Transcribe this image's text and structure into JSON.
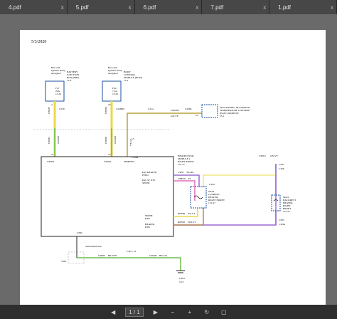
{
  "tabs": [
    {
      "label": "4.pdf",
      "close": "x"
    },
    {
      "label": "5.pdf",
      "close": "x"
    },
    {
      "label": "6.pdf",
      "close": "x"
    },
    {
      "label": "7.pdf",
      "close": "x"
    },
    {
      "label": "1.pdf",
      "close": "x"
    }
  ],
  "document": {
    "date": "5/3/2020",
    "modules": {
      "hot1": [
        "Hot with",
        "Ignition Relay",
        "energized"
      ],
      "hot2": [
        "Hot with",
        "Ignition Relay",
        "energized"
      ],
      "bjb": [
        "BATTERY",
        "JUNCTION",
        "BOX (BJB)"
      ],
      "bjb_ref": "11-6",
      "bcm": [
        "BODY",
        "CONTROL",
        "MODULE (BCM)"
      ],
      "bcm_ref": "11-4",
      "fuse1": [
        "F47",
        "20A",
        "13-25"
      ],
      "fuse2": [
        "F60",
        "7.5A",
        "13-25"
      ],
      "eatc": [
        "ELECTRONIC AUTOMATIC",
        "TEMPERATURE CONTROL",
        "(EATC) MODULE"
      ],
      "eatc_ref": "55-1",
      "seat_module": [
        "HEATED SEAT",
        "MODULE (",
        "RIGHT FRONT",
        "151-27"
      ],
      "pin_vpwr1": "VPWR",
      "pin_vpwr2": "VPWR",
      "pin_tempset": "TEMPSET",
      "pin_pas_feed": [
        "PAS HEATER",
        "FEED"
      ],
      "pin_pas_ntc": [
        "PAS ST NTC",
        "SENSE"
      ],
      "pin_sense_rtn": [
        "SENSE",
        "RTN"
      ],
      "pin_heater_rtn": [
        "HEATER",
        "RTN"
      ],
      "pin_gnd": "GND",
      "cushion": [
        "SEAT",
        "CUSHION",
        "HEATER,",
        "RIGHT FRONT",
        "151-27"
      ],
      "backrest": [
        "SEAT",
        "BACKREST",
        "HEATER,",
        "RIGHT",
        "FRONT",
        "151-27"
      ],
      "with_heated": "with heated seat",
      "ground_ref": "10-5"
    },
    "wires": {
      "w1": "CBP47",
      "w2": "CBP60",
      "w3": "CBP47",
      "w4": "GN-RD",
      "w5": "GN-RD",
      "w6": "CBP60",
      "w7": "VT-GY",
      "w8": "CE6208",
      "w9": "GN-YE",
      "w10": "VHE26",
      "w11": "VT",
      "w12": "CSE6",
      "w13": "YE-BU",
      "w14": "RHS09",
      "w15": "YE-VT",
      "w16": "RHS05",
      "w17": "WH-VT",
      "w18": "CSE01",
      "w19": "GN-VT",
      "w20": "GD901",
      "w21": "BK-WH",
      "w22": "GD200",
      "w23": "BK-GN"
    },
    "connectors": {
      "c1": "C250",
      "c2": "C2280D",
      "c3": "C228a",
      "c4": "C214",
      "c5": "C228b",
      "c6": "C334",
      "c7": "C305",
      "c8": "C326",
      "c9": "C305",
      "c10": "C326a",
      "c11": "C3I2 - 21",
      "c12": "G303",
      "c13": "S361",
      "p1": "2",
      "p2": "16",
      "p3": "21",
      "p4": "12",
      "p5": "15",
      "p6": "3",
      "p7": "4",
      "p8": "22",
      "p9": "24",
      "p10": "1",
      "p11": "2",
      "p12": "4",
      "p13": "5",
      "p14": "3",
      "p15": "8",
      "p16": "6",
      "p17": "9"
    }
  },
  "toolbar": {
    "page_current": "1",
    "page_sep": "/",
    "page_total": "1"
  },
  "colors": {
    "wire_yellow": "#e8d94a",
    "wire_green": "#6cbf4a",
    "wire_violet": "#9a6bd0",
    "wire_pink": "#e46fbf",
    "wire_olive": "#b7a23e",
    "wire_tan": "#b48a58"
  }
}
